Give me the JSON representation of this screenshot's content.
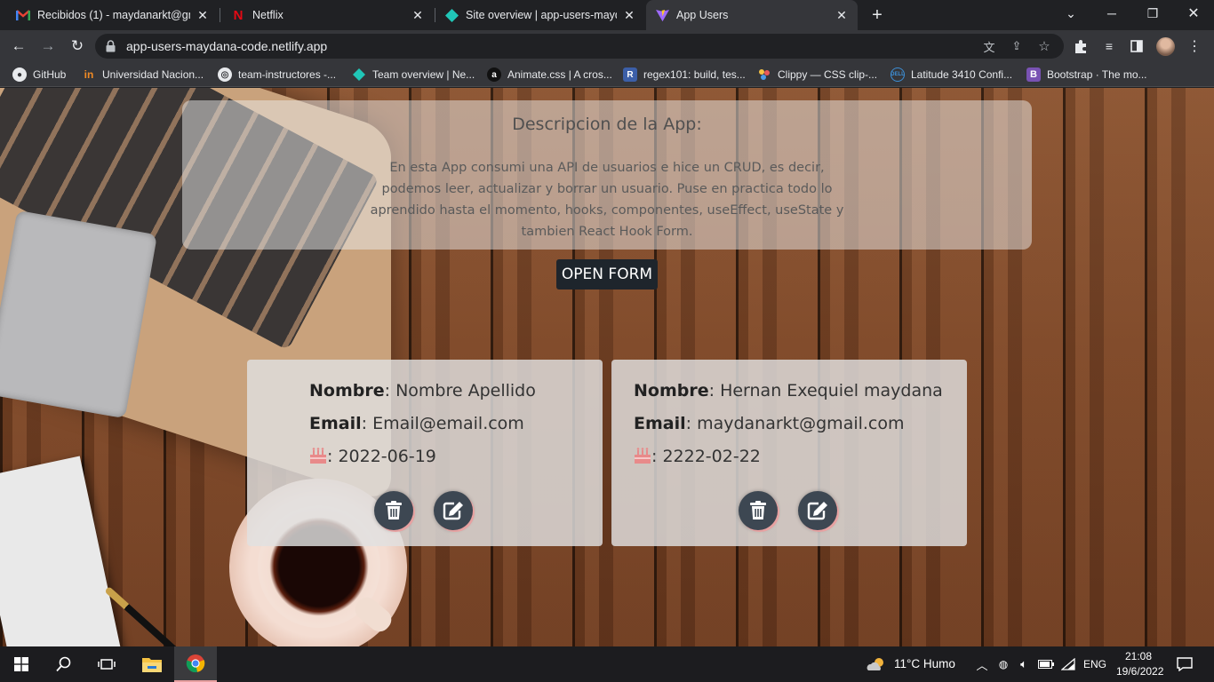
{
  "browser": {
    "tabs": [
      {
        "title": "Recibidos (1) - maydanarkt@gma",
        "icon": "gmail-icon",
        "active": false
      },
      {
        "title": "Netflix",
        "icon": "netflix-icon",
        "active": false
      },
      {
        "title": "Site overview | app-users-mayda",
        "icon": "netlify-icon",
        "active": false
      },
      {
        "title": "App Users",
        "icon": "vite-icon",
        "active": true
      }
    ],
    "url": "app-users-maydana-code.netlify.app",
    "bookmarks": [
      {
        "label": "GitHub",
        "icon": "github-icon"
      },
      {
        "label": "Universidad Nacion...",
        "icon": "university-icon"
      },
      {
        "label": "team-instructores -...",
        "icon": "team-icon"
      },
      {
        "label": "Team overview | Ne...",
        "icon": "netlify-icon"
      },
      {
        "label": "Animate.css | A cros...",
        "icon": "animate-icon"
      },
      {
        "label": "regex101: build, tes...",
        "icon": "regex-icon"
      },
      {
        "label": "Clippy — CSS clip-...",
        "icon": "clippy-icon"
      },
      {
        "label": "Latitude 3410 Confi...",
        "icon": "dell-icon"
      },
      {
        "label": "Bootstrap · The mo...",
        "icon": "bootstrap-icon"
      }
    ]
  },
  "app": {
    "description_title": "Descripcion de la App:",
    "description_text": "En esta App consumi una API de usuarios e hice un CRUD, es decir, podemos leer, actualizar y borrar un usuario. Puse en practica todo lo aprendido hasta el momento, hooks, componentes, useEffect, useState y tambien React Hook Form.",
    "open_form_label": "OPEN FORM",
    "name_label": "Nombre",
    "email_label": "Email",
    "users": [
      {
        "name": "Nombre Apellido",
        "email": "Email@email.com",
        "birthday": "2022-06-19"
      },
      {
        "name": "Hernan Exequiel maydana",
        "email": "maydanarkt@gmail.com",
        "birthday": "2222-02-22"
      }
    ],
    "accent_color": "#3d4752"
  },
  "taskbar": {
    "weather": "11°C  Humo",
    "language": "ENG",
    "time": "21:08",
    "date": "19/6/2022"
  }
}
